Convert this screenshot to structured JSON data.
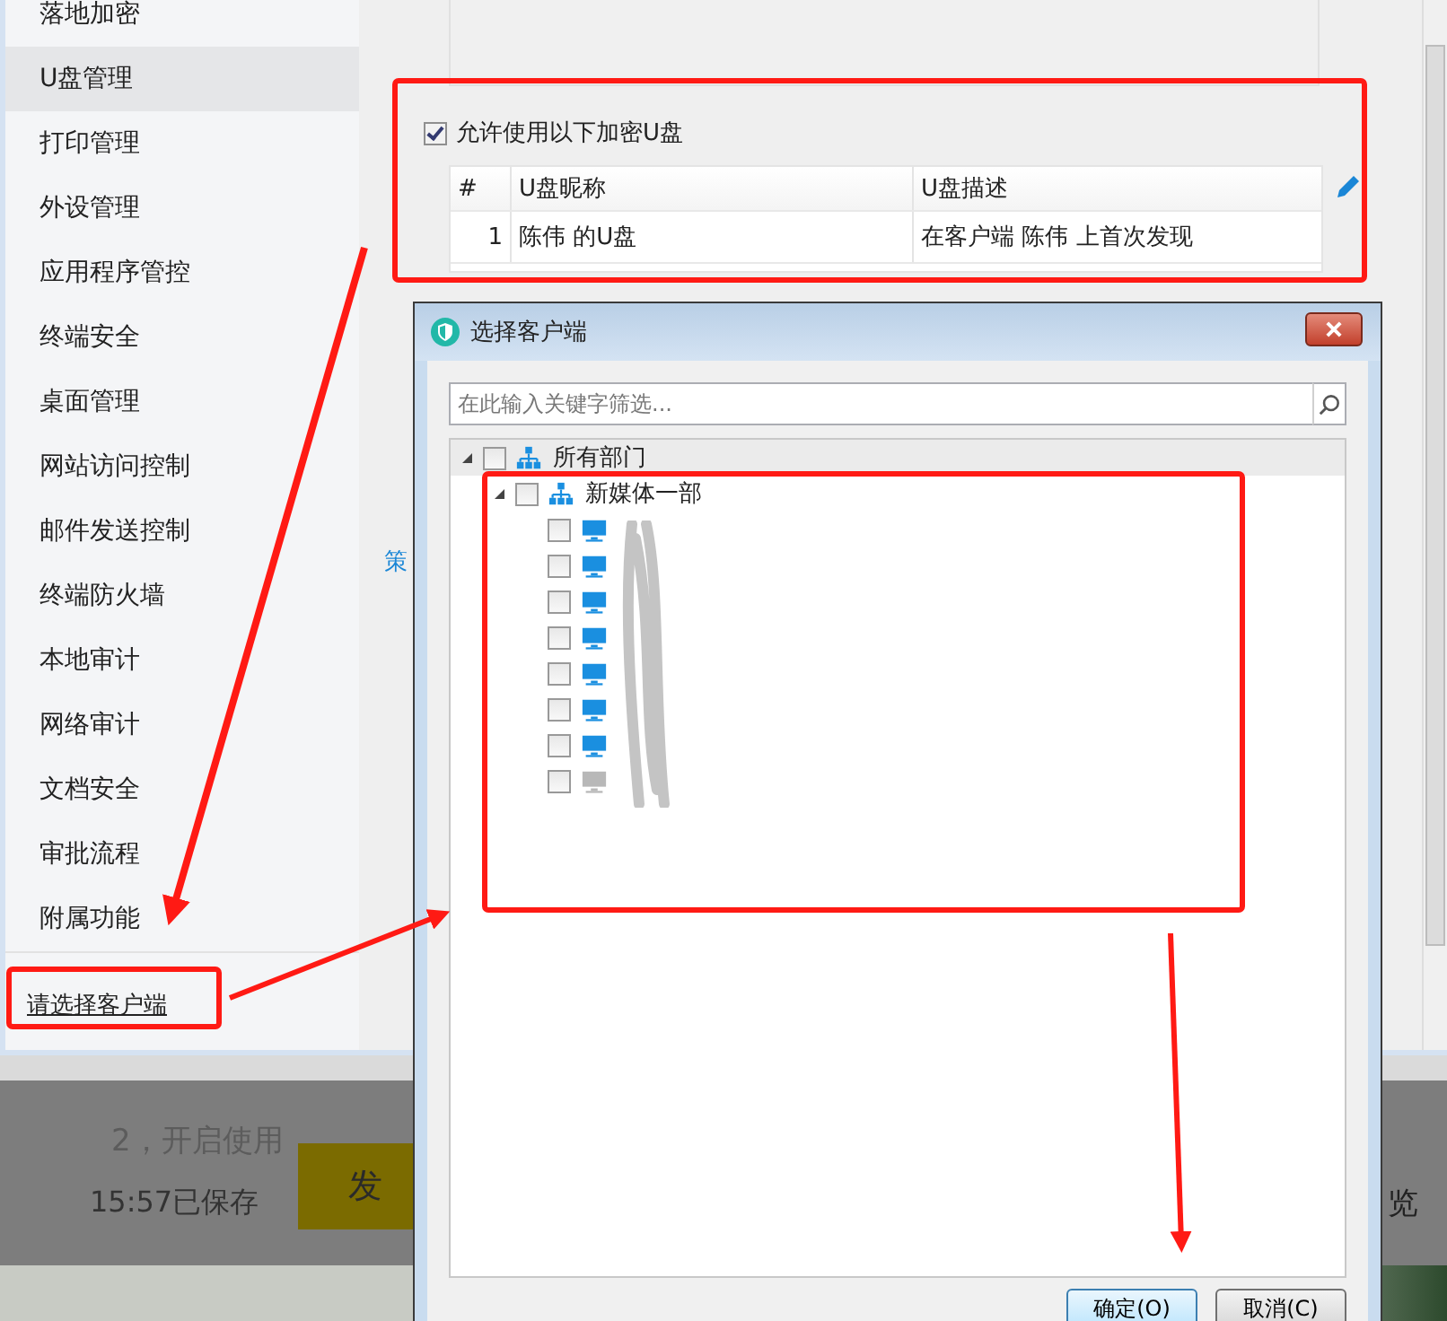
{
  "sidebar": {
    "items": [
      {
        "label": "落地加密",
        "selected": false
      },
      {
        "label": "U盘管理",
        "selected": true
      },
      {
        "label": "打印管理",
        "selected": false
      },
      {
        "label": "外设管理",
        "selected": false
      },
      {
        "label": "应用程序管控",
        "selected": false
      },
      {
        "label": "终端安全",
        "selected": false
      },
      {
        "label": "桌面管理",
        "selected": false
      },
      {
        "label": "网站访问控制",
        "selected": false
      },
      {
        "label": "邮件发送控制",
        "selected": false
      },
      {
        "label": "终端防火墙",
        "selected": false
      },
      {
        "label": "本地审计",
        "selected": false
      },
      {
        "label": "网络审计",
        "selected": false
      },
      {
        "label": "文档安全",
        "selected": false
      },
      {
        "label": "审批流程",
        "selected": false
      },
      {
        "label": "附属功能",
        "selected": false
      }
    ],
    "footer_link": "请选择客户端"
  },
  "main": {
    "allow_checkbox": {
      "label": "允许使用以下加密U盘",
      "checked": true
    },
    "table": {
      "columns": [
        "#",
        "U盘昵称",
        "U盘描述"
      ],
      "rows": [
        [
          "1",
          "陈伟 的U盘",
          "在客户端 陈伟 上首次发现"
        ]
      ]
    },
    "side_link": "策"
  },
  "background_page": {
    "step_text": "2，开启使用",
    "saved_text": "15:57已保存",
    "publish_button": "发",
    "preview_link": "览"
  },
  "dialog": {
    "title": "选择客户端",
    "search": {
      "placeholder": "在此输入关键字筛选..."
    },
    "tree": [
      {
        "kind": "department",
        "label": "所有部门",
        "expanded": true,
        "checked": false,
        "selected": true,
        "children": [
          {
            "kind": "department",
            "label": "新媒体一部",
            "expanded": true,
            "checked": false,
            "selected": false,
            "children": [
              {
                "kind": "computer",
                "online": true,
                "checked": false,
                "selected": false
              },
              {
                "kind": "computer",
                "online": true,
                "checked": false,
                "selected": false
              },
              {
                "kind": "computer",
                "online": true,
                "checked": false,
                "selected": false
              },
              {
                "kind": "computer",
                "online": true,
                "checked": false,
                "selected": false
              },
              {
                "kind": "computer",
                "online": true,
                "checked": false,
                "selected": false
              },
              {
                "kind": "computer",
                "online": true,
                "checked": false,
                "selected": false
              },
              {
                "kind": "computer",
                "online": true,
                "checked": false,
                "selected": false
              },
              {
                "kind": "computer",
                "online": false,
                "checked": false,
                "selected": false
              }
            ]
          }
        ]
      }
    ],
    "buttons": [
      {
        "label": "确定(O)",
        "default": true
      },
      {
        "label": "取消(C)",
        "default": false
      }
    ]
  }
}
